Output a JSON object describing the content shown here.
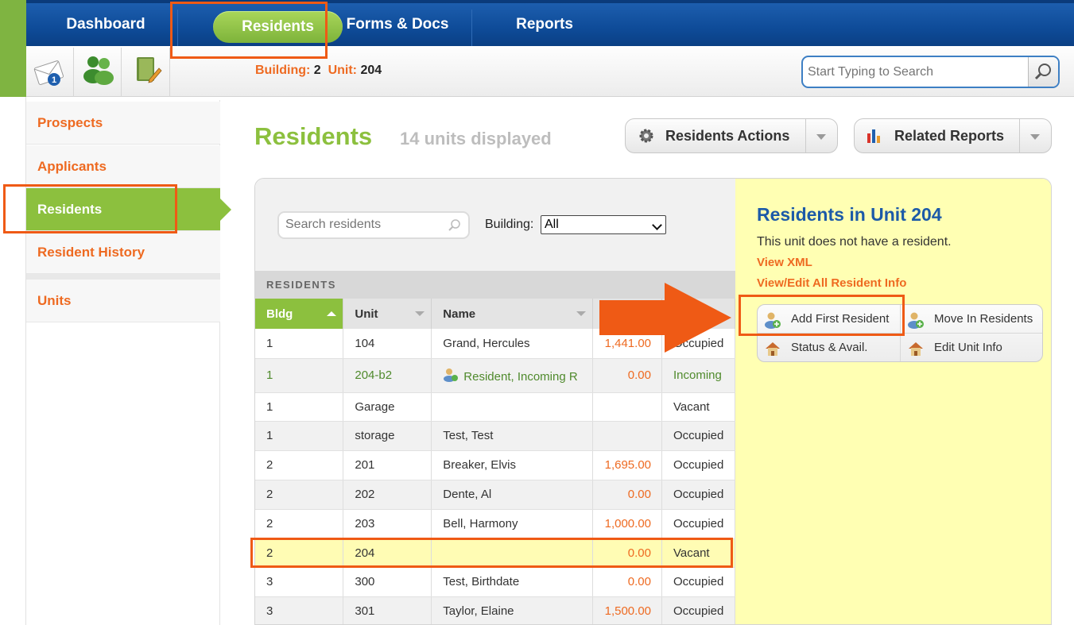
{
  "topnav": {
    "tabs": [
      {
        "label": "Dashboard"
      },
      {
        "label": "Residents"
      },
      {
        "label": "Forms & Docs"
      },
      {
        "label": "Reports"
      }
    ],
    "active_tab": "Residents"
  },
  "toolbar": {
    "notification_count": "1",
    "building_label": "Building:",
    "building_value": "2",
    "unit_label": "Unit:",
    "unit_value": "204",
    "search_placeholder": "Start Typing to Search"
  },
  "sidenav": {
    "items": [
      {
        "label": "Prospects"
      },
      {
        "label": "Applicants"
      },
      {
        "label": "Residents"
      },
      {
        "label": "Resident History"
      },
      {
        "label": "Units"
      }
    ],
    "active_item": "Residents"
  },
  "main": {
    "title": "Residents",
    "count_text": "14 units displayed",
    "actions_button": "Residents Actions",
    "reports_button": "Related Reports"
  },
  "list": {
    "search_placeholder": "Search residents",
    "building_filter_label": "Building:",
    "building_filter_value": "All",
    "section_caption": "RESIDENTS",
    "columns": [
      "Bldg",
      "Unit",
      "Name",
      "",
      ""
    ],
    "rows": [
      {
        "bldg": "1",
        "unit": "104",
        "name": "Grand, Hercules",
        "amount": "1,441.00",
        "status": "Occupied"
      },
      {
        "bldg": "1",
        "unit": "204-b2",
        "name": "Resident, Incoming R",
        "amount": "0.00",
        "status": "Incoming"
      },
      {
        "bldg": "1",
        "unit": "Garage",
        "name": "",
        "amount": "",
        "status": "Vacant"
      },
      {
        "bldg": "1",
        "unit": "storage",
        "name": "Test, Test",
        "amount": "",
        "status": "Occupied"
      },
      {
        "bldg": "2",
        "unit": "201",
        "name": "Breaker, Elvis",
        "amount": "1,695.00",
        "status": "Occupied"
      },
      {
        "bldg": "2",
        "unit": "202",
        "name": "Dente, Al",
        "amount": "0.00",
        "status": "Occupied"
      },
      {
        "bldg": "2",
        "unit": "203",
        "name": "Bell, Harmony",
        "amount": "1,000.00",
        "status": "Occupied"
      },
      {
        "bldg": "2",
        "unit": "204",
        "name": "",
        "amount": "0.00",
        "status": "Vacant"
      },
      {
        "bldg": "3",
        "unit": "300",
        "name": "Test, Birthdate",
        "amount": "0.00",
        "status": "Occupied"
      },
      {
        "bldg": "3",
        "unit": "301",
        "name": "Taylor, Elaine",
        "amount": "1,500.00",
        "status": "Occupied"
      }
    ]
  },
  "detail": {
    "title": "Residents in Unit 204",
    "message": "This unit does not have a resident.",
    "link_xml": "View XML",
    "link_edit_all": "View/Edit All Resident Info",
    "buttons": {
      "add_first": "Add First Resident",
      "move_in": "Move In Residents",
      "status": "Status & Avail.",
      "edit_unit": "Edit Unit Info"
    }
  },
  "colors": {
    "accent_orange": "#ee6a21",
    "brand_green": "#8cc03e",
    "nav_blue": "#0e4b98",
    "annotation": "#ef5a15"
  }
}
